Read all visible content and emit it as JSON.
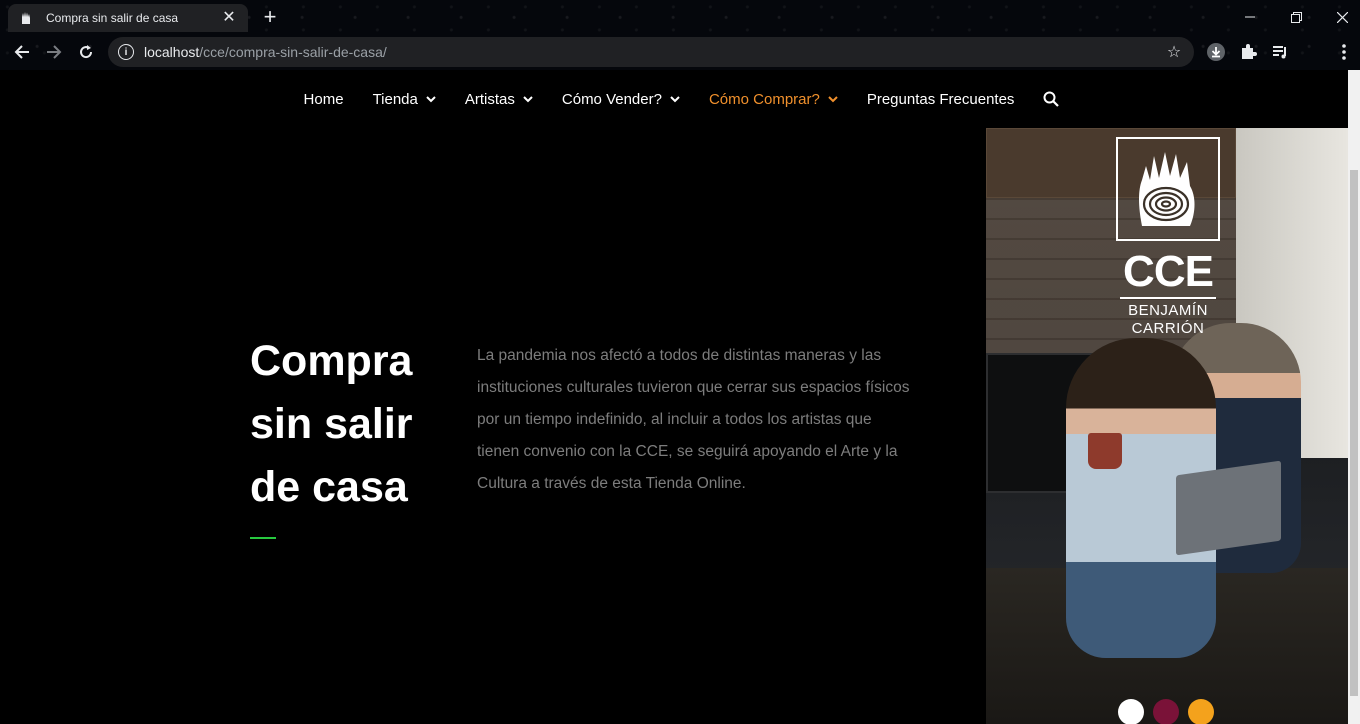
{
  "browser": {
    "tab_title": "Compra sin salir de casa",
    "url_host": "localhost",
    "url_path": "/cce/compra-sin-salir-de-casa/",
    "icons": [
      "hand-favicon-icon",
      "close-icon",
      "plus-icon",
      "minimize-icon",
      "restore-icon",
      "close-window-icon",
      "back-icon",
      "forward-icon",
      "reload-icon",
      "info-icon",
      "star-icon",
      "download-icon",
      "extensions-icon",
      "media-playlist-icon",
      "menu-icon"
    ]
  },
  "nav": {
    "items": [
      {
        "label": "Home",
        "dropdown": false,
        "active": false
      },
      {
        "label": "Tienda",
        "dropdown": true,
        "active": false
      },
      {
        "label": "Artistas",
        "dropdown": true,
        "active": false
      },
      {
        "label": "Cómo Vender?",
        "dropdown": true,
        "active": false
      },
      {
        "label": "Cómo Comprar?",
        "dropdown": true,
        "active": true
      },
      {
        "label": "Preguntas Frecuentes",
        "dropdown": false,
        "active": false
      }
    ],
    "active_color": "#f0902c"
  },
  "hero": {
    "title_line1": "Compra",
    "title_line2": "sin salir",
    "title_line3": "de casa",
    "accent_color": "#27c93f",
    "text": "La pandemia nos afectó a todos de distintas maneras y las instituciones culturales tuvieron que cerrar sus espacios físicos por un tiempo indefinido, al incluir a todos los artistas que tienen convenio con la CCE, se seguirá apoyando el Arte y la Cultura a través de esta Tienda Online."
  },
  "logo": {
    "name": "CCE",
    "line1": "BENJAMÍN",
    "line2": "CARRIÓN"
  },
  "color_dots": [
    "#ffffff",
    "#7a1238",
    "#f4a21c"
  ]
}
